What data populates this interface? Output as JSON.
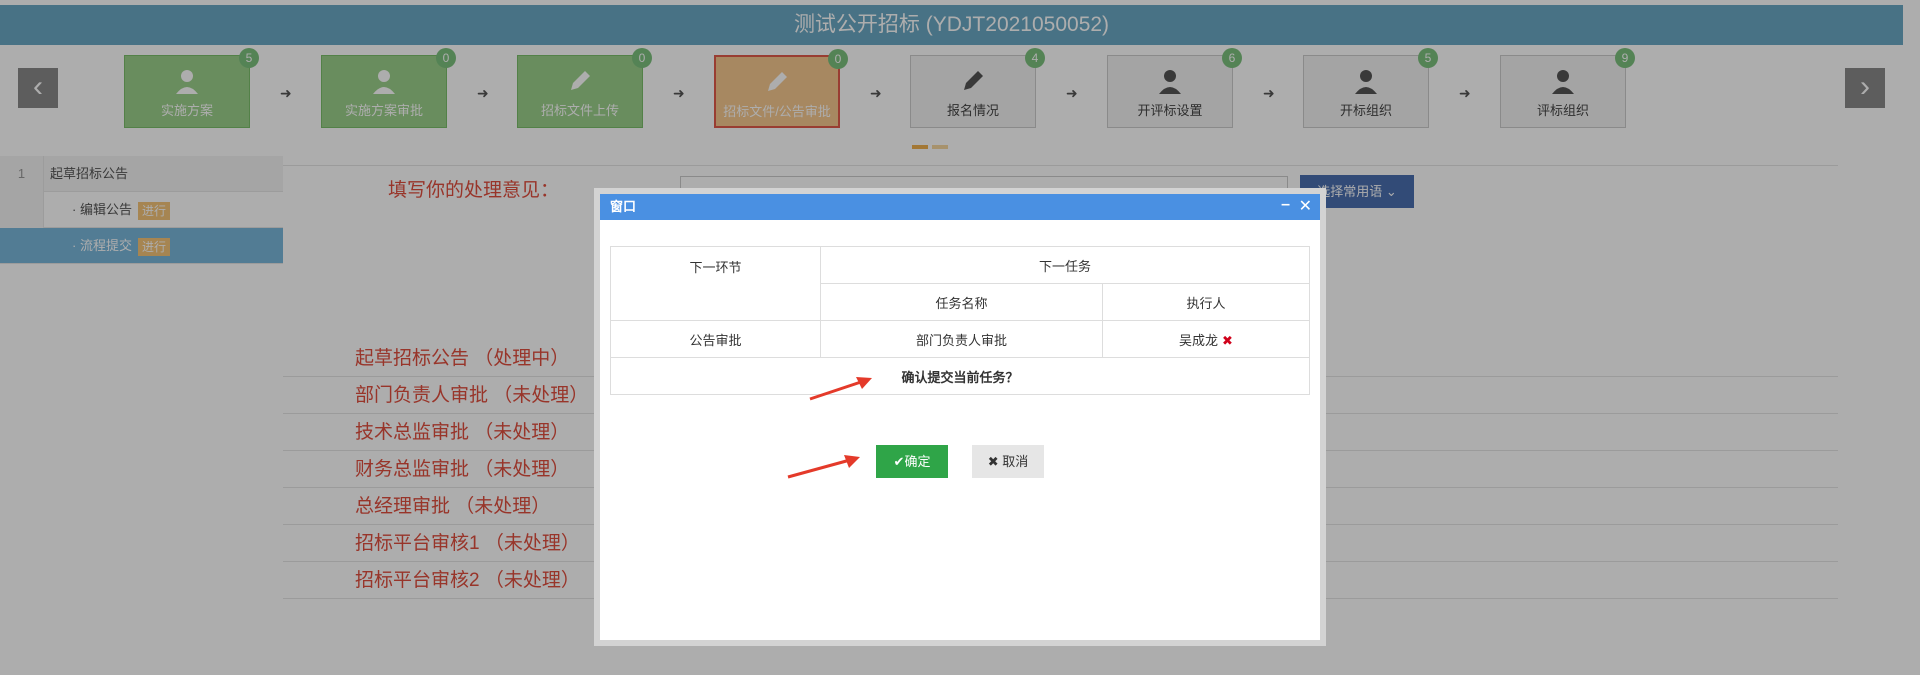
{
  "title": "测试公开招标 (YDJT2021050052)",
  "steps": [
    {
      "label": "实施方案",
      "count": "5",
      "state": "done"
    },
    {
      "label": "实施方案审批",
      "count": "0",
      "state": "done"
    },
    {
      "label": "招标文件上传",
      "count": "0",
      "state": "done"
    },
    {
      "label": "招标文件/公告审批",
      "count": "0",
      "state": "active"
    },
    {
      "label": "报名情况",
      "count": "4",
      "state": "pending"
    },
    {
      "label": "开评标设置",
      "count": "6",
      "state": "pending"
    },
    {
      "label": "开标组织",
      "count": "5",
      "state": "pending"
    },
    {
      "label": "评标组织",
      "count": "9",
      "state": "pending"
    }
  ],
  "sidebar": {
    "group_num": "1",
    "group_label": "起草招标公告",
    "items": [
      {
        "label": "· 编辑公告",
        "tag": "进行"
      },
      {
        "label": "· 流程提交",
        "tag": "进行"
      }
    ]
  },
  "opinion_label": "填写你的处理意见：",
  "phrase_button": "选择常用语",
  "approval_steps": [
    "起草招标公告 （处理中）",
    "部门负责人审批 （未处理）",
    "技术总监审批 （未处理）",
    "财务总监审批 （未处理）",
    "总经理审批 （未处理）",
    "招标平台审核1 （未处理）",
    "招标平台审核2 （未处理）"
  ],
  "dialog": {
    "title": "窗口",
    "col_next_node": "下一环节",
    "col_next_task": "下一任务",
    "col_task_name": "任务名称",
    "col_executor": "执行人",
    "row_node": "公告审批",
    "row_task": "部门负责人审批",
    "row_executor": "吴成龙",
    "confirm_question": "确认提交当前任务？",
    "ok_label": "确定",
    "cancel_label": "取消"
  },
  "colors": {
    "title_bar": "#6aa9c4",
    "done_step": "#9bd08b",
    "active_step": "#f7c98f",
    "ok_button": "#2fa548",
    "dialog_header": "#4a90e2"
  }
}
